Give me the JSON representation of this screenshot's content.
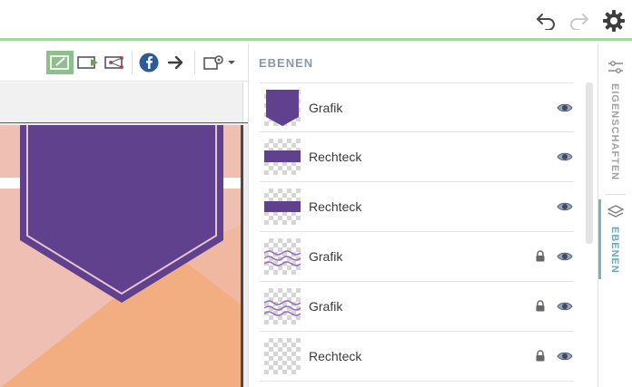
{
  "colors": {
    "accent_green": "#8fbf8d",
    "top_border": "#a6d4a4",
    "purple": "#5f418e",
    "active_tab": "#6aa8b8",
    "muted_text": "#8a9aa4"
  },
  "topbar": {
    "undo_icon": "undo-icon",
    "redo_icon": "redo-icon",
    "settings_icon": "gear-icon"
  },
  "toolbar": {
    "tools": [
      "edit-icon",
      "video-icon",
      "share-network-icon",
      "facebook-icon",
      "arrow-right-icon",
      "settings-dropdown-icon"
    ]
  },
  "layers_panel": {
    "title": "EBENEN",
    "layers": [
      {
        "name": "Grafik",
        "thumb": "banner-thumb",
        "locked": false,
        "visible": true
      },
      {
        "name": "Rechteck",
        "thumb": "bar-thumb",
        "locked": false,
        "visible": true
      },
      {
        "name": "Rechteck",
        "thumb": "bar-thumb",
        "locked": false,
        "visible": true
      },
      {
        "name": "Grafik",
        "thumb": "wave-thumb",
        "locked": true,
        "visible": true
      },
      {
        "name": "Grafik",
        "thumb": "wave-thumb",
        "locked": true,
        "visible": true
      },
      {
        "name": "Rechteck",
        "thumb": "empty-thumb",
        "locked": true,
        "visible": true
      }
    ]
  },
  "side_tabs": {
    "properties": "EIGENSCHAFTEN",
    "layers": "EBENEN"
  }
}
